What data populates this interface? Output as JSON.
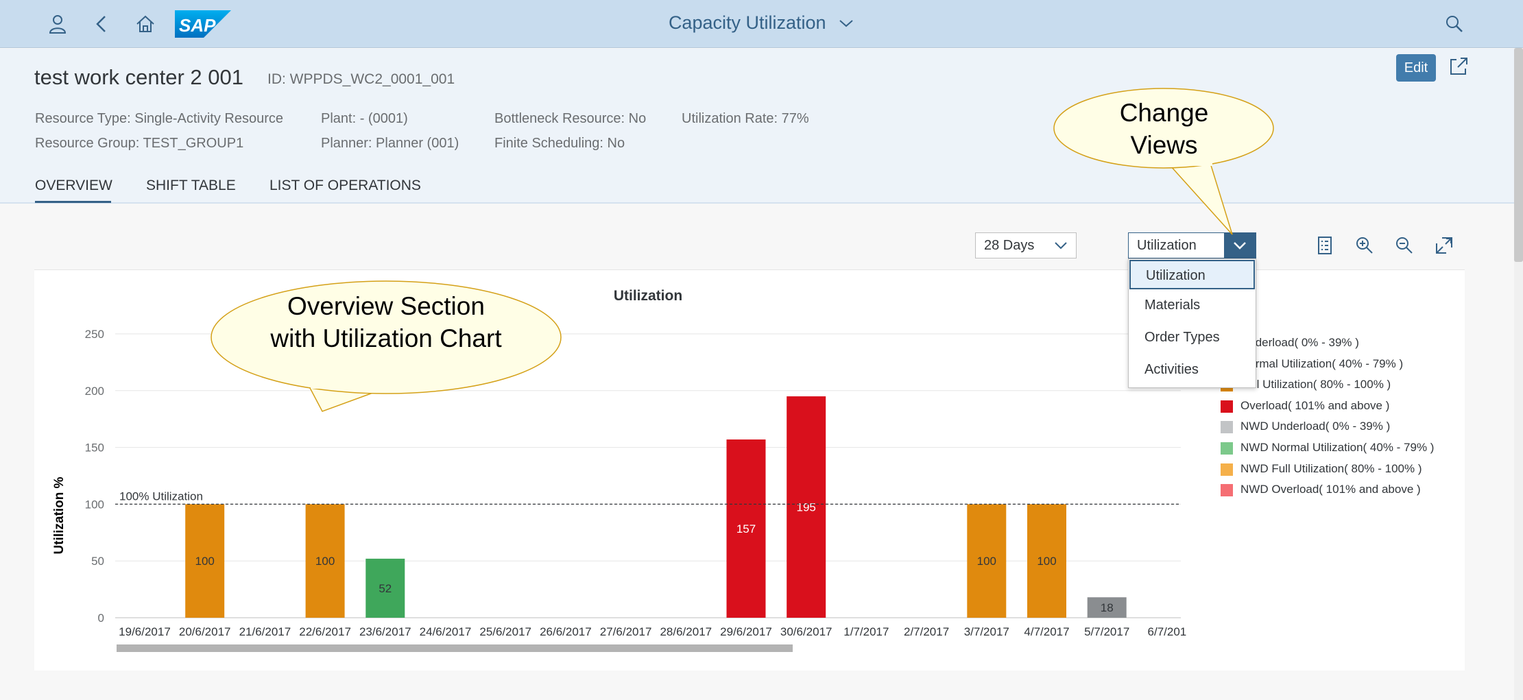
{
  "shell": {
    "title": "Capacity Utilization"
  },
  "header": {
    "title": "test work center 2 001",
    "id": "ID: WPPDS_WC2_0001_001",
    "attributes": [
      "Resource Type: Single-Activity Resource",
      "Resource Group: TEST_GROUP1",
      "Plant: - (0001)",
      "Planner: Planner (001)",
      "Bottleneck Resource: No",
      "Finite Scheduling: No",
      "Utilization Rate: 77%"
    ],
    "edit_label": "Edit"
  },
  "tabs": [
    {
      "label": "OVERVIEW",
      "active": true
    },
    {
      "label": "SHIFT TABLE",
      "active": false
    },
    {
      "label": "LIST OF OPERATIONS",
      "active": false
    }
  ],
  "toolbar": {
    "days": "28 Days",
    "view": "Utilization",
    "view_options": [
      "Utilization",
      "Materials",
      "Order Types",
      "Activities"
    ]
  },
  "callouts": {
    "change_views": "Change Views",
    "overview": "Overview Section with Utilization Chart"
  },
  "legend": [
    {
      "label": "Underload( 0% - 39% )",
      "color": "#d9d9d9"
    },
    {
      "label": "Normal Utilization( 40% - 79% )",
      "color": "#3fa75b"
    },
    {
      "label": "Full Utilization( 80% - 100% )",
      "color": "#e08a0e"
    },
    {
      "label": "Overload( 101% and above )",
      "color": "#d9101c"
    },
    {
      "label": "NWD Underload( 0% - 39% )",
      "color": "#c2c4c6"
    },
    {
      "label": "NWD Normal Utilization( 40% - 79% )",
      "color": "#7cc98b"
    },
    {
      "label": "NWD Full Utilization( 80% - 100% )",
      "color": "#f5b04a"
    },
    {
      "label": "NWD Overload( 101% and above )",
      "color": "#f56e73"
    }
  ],
  "chart_data": {
    "type": "bar",
    "title": "Utilization",
    "ylabel": "Utilization %",
    "xlabel": "",
    "ylim": [
      0,
      250
    ],
    "yticks": [
      0,
      50,
      100,
      150,
      200,
      250
    ],
    "reference_line": {
      "value": 100,
      "label": "100% Utilization"
    },
    "categories": [
      "19/6/2017",
      "20/6/2017",
      "21/6/2017",
      "22/6/2017",
      "23/6/2017",
      "24/6/2017",
      "25/6/2017",
      "26/6/2017",
      "27/6/2017",
      "28/6/2017",
      "29/6/2017",
      "30/6/2017",
      "1/7/2017",
      "2/7/2017",
      "3/7/2017",
      "4/7/2017",
      "5/7/2017",
      "6/7/201"
    ],
    "values": [
      null,
      100,
      null,
      100,
      52,
      null,
      null,
      null,
      null,
      null,
      157,
      195,
      null,
      null,
      100,
      100,
      18,
      null
    ],
    "colors": [
      null,
      "#e08a0e",
      null,
      "#e08a0e",
      "#3fa75b",
      null,
      null,
      null,
      null,
      null,
      "#d9101c",
      "#d9101c",
      null,
      null,
      "#e08a0e",
      "#e08a0e",
      "#8a8d90",
      null
    ],
    "label_colors": [
      null,
      "#32363a",
      null,
      "#32363a",
      "#32363a",
      null,
      null,
      null,
      null,
      null,
      "#ffffff",
      "#ffffff",
      null,
      null,
      "#32363a",
      "#32363a",
      "#32363a",
      null
    ]
  }
}
